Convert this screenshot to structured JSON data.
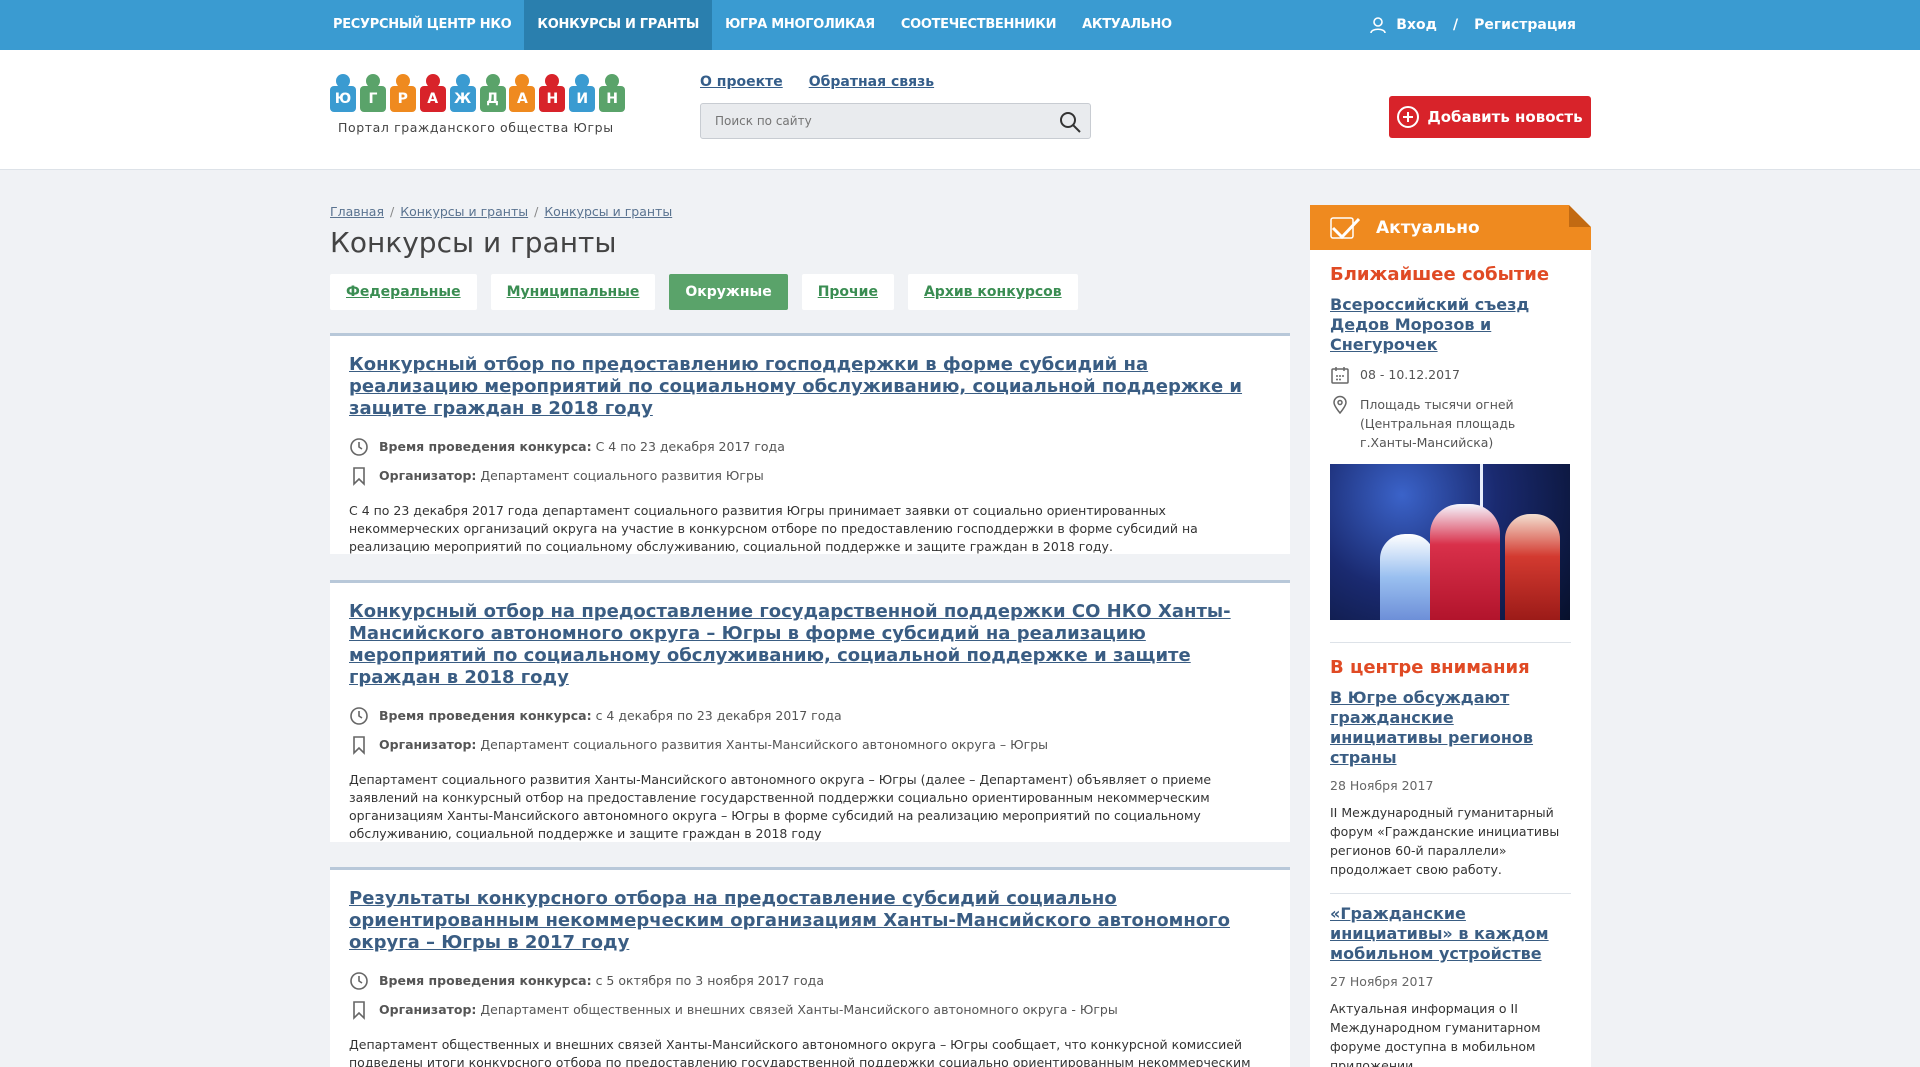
{
  "nav": {
    "items": [
      {
        "label": "Ресурсный центр НКО",
        "active": false
      },
      {
        "label": "Конкурсы и гранты",
        "active": true
      },
      {
        "label": "Югра многоликая",
        "active": false
      },
      {
        "label": "Соотечественники",
        "active": false
      },
      {
        "label": "Актуально",
        "active": false
      }
    ],
    "login": "Вход",
    "separator": "/",
    "register": "Регистрация"
  },
  "header": {
    "logo_letters": [
      "Ю",
      "Г",
      "Р",
      "А",
      "Ж",
      "Д",
      "А",
      "Н",
      "И",
      "Н"
    ],
    "logo_colors": [
      "#3a9bd1",
      "#5aa36a",
      "#ef8a1f",
      "#d8232a",
      "#3a9bd1",
      "#5aa36a",
      "#ef8a1f",
      "#d8232a",
      "#3a9bd1",
      "#5aa36a"
    ],
    "tagline": "Портал гражданского общества Югры",
    "about": "О проекте",
    "feedback": "Обратная связь",
    "search_placeholder": "Поиск по сайту",
    "add_news": "Добавить новость"
  },
  "breadcrumbs": [
    "Главная",
    "Конкурсы и гранты",
    "Конкурсы и гранты"
  ],
  "page_title": "Конкурсы и гранты",
  "tabs": [
    {
      "label": "Федеральные",
      "active": false
    },
    {
      "label": "Муниципальные",
      "active": false
    },
    {
      "label": "Окружные",
      "active": true
    },
    {
      "label": "Прочие",
      "active": false
    },
    {
      "label": "Архив конкурсов",
      "active": false
    }
  ],
  "cards": [
    {
      "title": "Конкурсный отбор по предоставлению господдержки в форме субсидий на реализацию мероприятий по социальному обслуживанию, социальной поддержке и защите граждан в 2018 году",
      "time_label": "Время проведения конкурса:",
      "time": "С 4 по 23 декабря 2017 года",
      "org_label": "Организатор:",
      "org": "Департамент социального развития Югры",
      "desc": "С 4 по 23 декабря 2017 года департамент социального развития Югры принимает заявки от социально ориентированных некоммерческих организаций округа на участие в конкурсном отборе по предоставлению господдержки в форме субсидий на реализацию мероприятий по социальному обслуживанию, социальной поддержке и защите граждан в 2018 году."
    },
    {
      "title": "Конкурсный отбор на предоставление государственной поддержки СО НКО Ханты-Мансийского автономного округа – Югры в форме субсидий на реализацию мероприятий по социальному обслуживанию, социальной поддержке и защите граждан в 2018 году",
      "time_label": "Время проведения конкурса:",
      "time": "с 4 декабря по 23 декабря 2017 года",
      "org_label": "Организатор:",
      "org": "Департамент социального развития Ханты-Мансийского автономного округа – Югры",
      "desc": "Департамент социального развития Ханты-Мансийского автономного округа – Югры (далее – Департамент) объявляет о приеме заявлений на конкурсный отбор на предоставление государственной поддержки социально ориентированным некоммерческим организациям Ханты-Мансийского автономного округа – Югры в форме субсидий на реализацию мероприятий по социальному обслуживанию, социальной поддержке и защите граждан в 2018 году"
    },
    {
      "title": "Результаты конкурсного отбора на предоставление субсидий социально ориентированным некоммерческим организациям Ханты-Мансийского автономного округа – Югры в 2017 году",
      "time_label": "Время проведения конкурса:",
      "time": "с 5 октября по 3 ноября 2017 года",
      "org_label": "Организатор:",
      "org": "Департамент общественных и внешних связей Ханты-Мансийского автономного округа - Югры",
      "desc": "Департамент общественных и внешних связей Ханты-Мансийского автономного округа – Югры сообщает, что конкурсной комиссией подведены итоги конкурсного отбора по предоставлению государственной поддержки социально ориентированным некоммерческим организациям Ханты-Мансийского автономного округа – Югры."
    }
  ],
  "sidebar": {
    "title": "Актуально",
    "event_section": "Ближайшее событие",
    "event_title": "Всероссийский съезд Дедов Морозов и Снегурочек",
    "event_date": "08 - 10.12.2017",
    "event_place": "Площадь тысячи огней (Центральная площадь г.Ханты-Мансийска)",
    "focus_section": "В центре внимания",
    "news": [
      {
        "title": "В Югре обсуждают гражданские инициативы регионов страны",
        "date": "28 Ноября 2017",
        "text": "II Международный гуманитарный форум «Гражданские инициативы регионов 60-й параллели» продолжает свою работу."
      },
      {
        "title": "«Гражданские инициативы» в каждом мобильном устройстве",
        "date": "27 Ноября 2017",
        "text": "Актуальная информация о II Международном гуманитарном форуме доступна в мобильном приложении."
      }
    ]
  }
}
